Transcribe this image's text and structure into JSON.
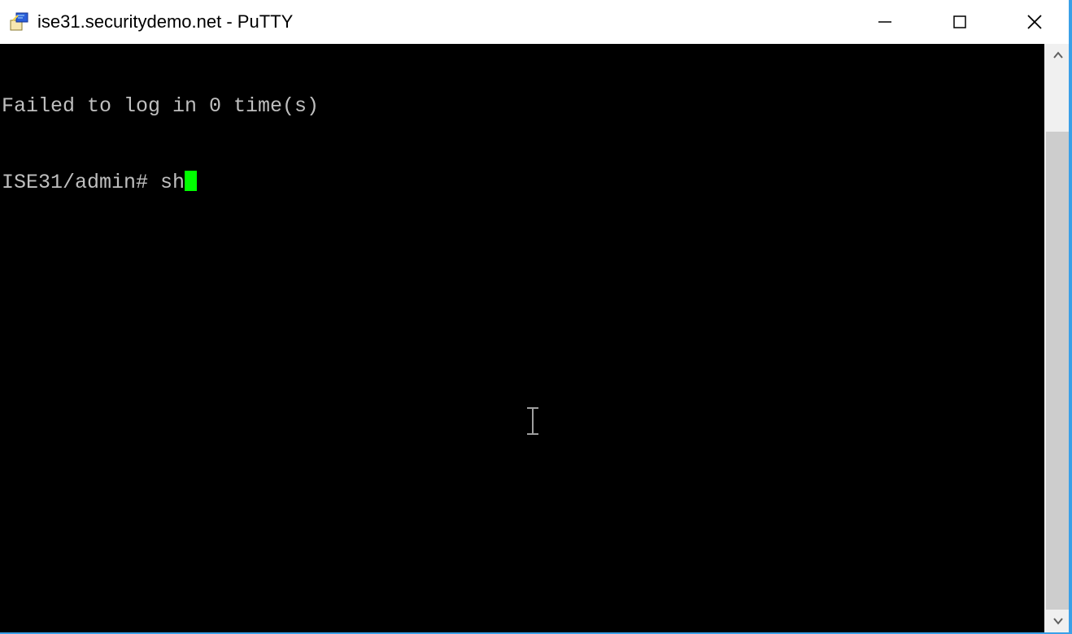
{
  "window": {
    "title": "ise31.securitydemo.net - PuTTY"
  },
  "terminal": {
    "line1": "Failed to log in 0 time(s)",
    "prompt": "ISE31/admin# ",
    "typed": "sh"
  }
}
